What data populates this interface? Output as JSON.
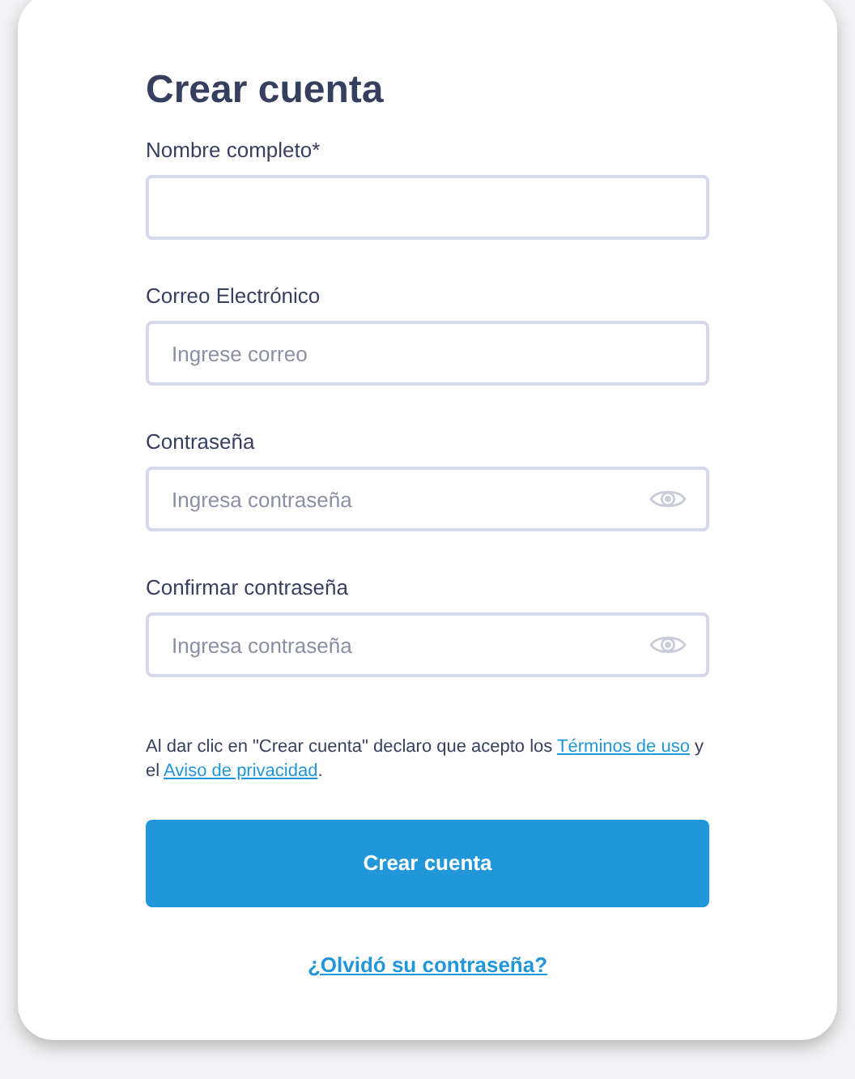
{
  "title": "Crear cuenta",
  "fields": [
    {
      "label": "Nombre completo*",
      "kind": "text"
    },
    {
      "label": "Correo Electrónico",
      "kind": "text",
      "placeholder": "Ingrese correo"
    },
    {
      "label": "Contraseña",
      "kind": "password",
      "placeholder": "Ingresa contraseña"
    },
    {
      "label": "Confirmar contraseña",
      "kind": "password",
      "placeholder": "Ingresa contraseña"
    }
  ],
  "terms": [
    {
      "kind": "text",
      "text": "Al dar clic en \"Crear cuenta\" declaro que acepto los"
    },
    {
      "kind": "link",
      "text": "Términos de uso"
    },
    {
      "kind": "text",
      "text": "y el"
    },
    {
      "kind": "link",
      "text": "Aviso de privacidad"
    },
    {
      "kind": "text",
      "text": "."
    }
  ],
  "submit_button": "Crear cuenta",
  "forgot_link": "¿Olvidó su contraseña?"
}
